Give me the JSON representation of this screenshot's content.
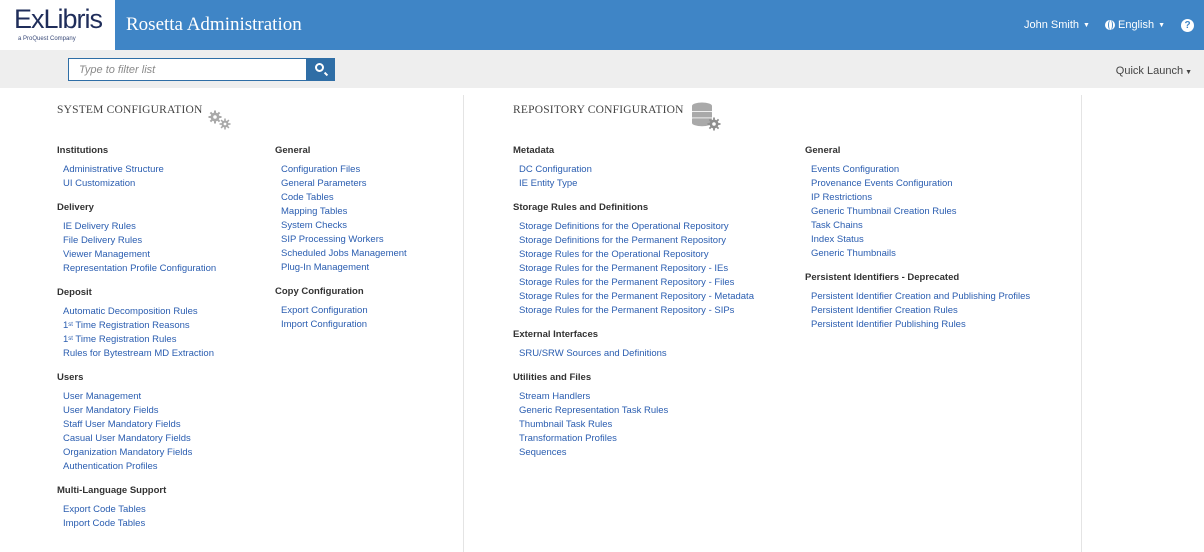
{
  "header": {
    "logo_text": "ExLibris",
    "logo_sub": "a ProQuest Company",
    "app_title": "Rosetta Administration",
    "user_name": "John Smith",
    "language": "English",
    "help_label": "?"
  },
  "search": {
    "placeholder": "Type to filter list"
  },
  "quick_launch": "Quick Launch",
  "system_config": {
    "title": "SYSTEM CONFIGURATION",
    "col1": [
      {
        "header": "Institutions",
        "items": [
          "Administrative Structure",
          "UI Customization"
        ]
      },
      {
        "header": "Delivery",
        "items": [
          "IE Delivery Rules",
          "File Delivery Rules",
          "Viewer Management",
          "Representation Profile Configuration"
        ]
      },
      {
        "header": "Deposit",
        "items": [
          "Automatic Decomposition Rules",
          "1st Time Registration Reasons",
          "1st Time Registration Rules",
          "Rules for Bytestream MD Extraction"
        ]
      },
      {
        "header": "Users",
        "items": [
          "User Management",
          "User Mandatory Fields",
          "Staff User Mandatory Fields",
          "Casual User Mandatory Fields",
          "Organization Mandatory Fields",
          "Authentication Profiles"
        ]
      },
      {
        "header": "Multi-Language Support",
        "items": [
          "Export Code Tables",
          "Import Code Tables"
        ]
      }
    ],
    "col2": [
      {
        "header": "General",
        "items": [
          "Configuration Files",
          "General Parameters",
          "Code Tables",
          "Mapping Tables",
          "System Checks",
          "SIP Processing Workers",
          "Scheduled Jobs Management",
          "Plug-In Management"
        ]
      },
      {
        "header": "Copy Configuration",
        "items": [
          "Export Configuration",
          "Import Configuration"
        ]
      }
    ]
  },
  "repo_config": {
    "title": "REPOSITORY CONFIGURATION",
    "col1": [
      {
        "header": "Metadata",
        "items": [
          "DC Configuration",
          "IE Entity Type"
        ]
      },
      {
        "header": "Storage Rules and Definitions",
        "items": [
          "Storage Definitions for the Operational Repository",
          "Storage Definitions for the Permanent Repository",
          "Storage Rules for the Operational Repository",
          "Storage Rules for the Permanent Repository - IEs",
          "Storage Rules for the Permanent Repository - Files",
          "Storage Rules for the Permanent Repository - Metadata",
          "Storage Rules for the Permanent Repository - SIPs"
        ]
      },
      {
        "header": "External Interfaces",
        "items": [
          "SRU/SRW Sources and Definitions"
        ]
      },
      {
        "header": "Utilities and Files",
        "items": [
          "Stream Handlers",
          "Generic Representation Task Rules",
          "Thumbnail Task Rules",
          "Transformation Profiles",
          "Sequences"
        ]
      }
    ],
    "col2": [
      {
        "header": "General",
        "items": [
          "Events Configuration",
          "Provenance Events Configuration",
          "IP Restrictions",
          "Generic Thumbnail Creation Rules",
          "Task Chains",
          "Index Status",
          "Generic Thumbnails"
        ]
      },
      {
        "header": "Persistent Identifiers - Deprecated",
        "items": [
          "Persistent Identifier Creation and Publishing Profiles",
          "Persistent Identifier Creation Rules",
          "Persistent Identifier Publishing Rules"
        ]
      }
    ]
  },
  "colors": {
    "topbar": "#3f85c6",
    "search_button": "#2f6ea6",
    "link": "#2a5db0",
    "subbar": "#eeeeee"
  },
  "icons": {
    "system_config": "gears-icon",
    "repo_config": "database-gear-icon",
    "search": "search-icon",
    "help": "help-icon",
    "language": "globe-icon"
  }
}
